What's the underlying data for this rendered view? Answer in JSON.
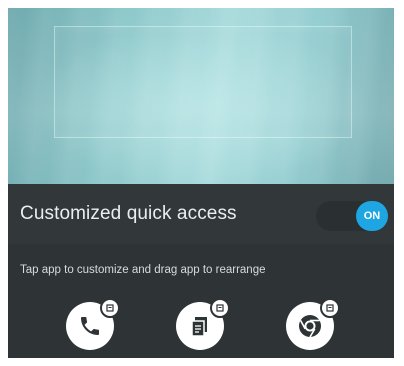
{
  "panel": {
    "title": "Customized quick access",
    "toggle_label": "ON",
    "hint": "Tap app to customize and drag app to rearrange"
  },
  "apps": [
    {
      "icon": "phone-icon"
    },
    {
      "icon": "memo-icon"
    },
    {
      "icon": "chrome-icon"
    }
  ],
  "colors": {
    "toggle_on": "#1ea6e2",
    "panel_bg": "#2e3335"
  }
}
